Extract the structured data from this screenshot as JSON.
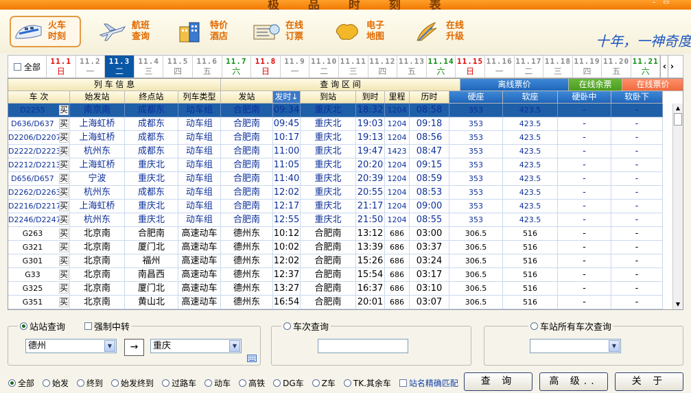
{
  "window": {
    "title": "极 品 时 刻 表",
    "btn_min": "–",
    "btn_max": "▭"
  },
  "toolbar": {
    "items": [
      {
        "label": "火车时刻",
        "icon": "train-icon"
      },
      {
        "label": "航班查询",
        "icon": "airplane-icon"
      },
      {
        "label": "特价酒店",
        "icon": "hotel-icon"
      },
      {
        "label": "在线订票",
        "icon": "ticket-icon"
      },
      {
        "label": "电子地图",
        "icon": "map-icon"
      },
      {
        "label": "在线升级",
        "icon": "upgrade-icon"
      }
    ],
    "signature": "十年，一神奇度"
  },
  "dates": {
    "all_label": "全部",
    "items": [
      {
        "d": "11.1",
        "w": "日",
        "type": "sun"
      },
      {
        "d": "11.2",
        "w": "一",
        "type": ""
      },
      {
        "d": "11.3",
        "w": "二",
        "type": "sel"
      },
      {
        "d": "11.4",
        "w": "三",
        "type": ""
      },
      {
        "d": "11.5",
        "w": "四",
        "type": ""
      },
      {
        "d": "11.6",
        "w": "五",
        "type": ""
      },
      {
        "d": "11.7",
        "w": "六",
        "type": "sat"
      },
      {
        "d": "11.8",
        "w": "日",
        "type": "sun"
      },
      {
        "d": "11.9",
        "w": "一",
        "type": ""
      },
      {
        "d": "11.10",
        "w": "二",
        "type": ""
      },
      {
        "d": "11.11",
        "w": "三",
        "type": ""
      },
      {
        "d": "11.12",
        "w": "四",
        "type": ""
      },
      {
        "d": "11.13",
        "w": "五",
        "type": ""
      },
      {
        "d": "11.14",
        "w": "六",
        "type": "sat"
      },
      {
        "d": "11.15",
        "w": "日",
        "type": "sun"
      },
      {
        "d": "11.16",
        "w": "一",
        "type": ""
      },
      {
        "d": "11.17",
        "w": "二",
        "type": ""
      },
      {
        "d": "11.18",
        "w": "三",
        "type": ""
      },
      {
        "d": "11.19",
        "w": "四",
        "type": ""
      },
      {
        "d": "11.20",
        "w": "五",
        "type": ""
      },
      {
        "d": "11.21",
        "w": "六",
        "type": "sat"
      }
    ]
  },
  "table": {
    "group_headers": {
      "train_info": "列 车 信 息",
      "query_range": "查 询 区 间",
      "offline_price": "离线票价",
      "online_remaining": "在线余票",
      "online_price": "在线票价"
    },
    "columns": [
      "车 次",
      "始发站",
      "终点站",
      "列车类型",
      "发站",
      "发时↓",
      "到站",
      "到时",
      "里程",
      "历时",
      "硬座",
      "软座",
      "硬卧中",
      "软卧下"
    ],
    "buy_label": "买",
    "rows": [
      [
        "D2255",
        "南京南",
        "成都东",
        "动车组",
        "合肥南",
        "09:34",
        "重庆北",
        "18:32",
        "1204",
        "08:58",
        "353",
        "423.5",
        "-",
        "-"
      ],
      [
        "D636/D637",
        "上海虹桥",
        "成都东",
        "动车组",
        "合肥南",
        "09:45",
        "重庆北",
        "19:03",
        "1204",
        "09:18",
        "353",
        "423.5",
        "-",
        "-"
      ],
      [
        "D2206/D2207",
        "上海虹桥",
        "成都东",
        "动车组",
        "合肥南",
        "10:17",
        "重庆北",
        "19:13",
        "1204",
        "08:56",
        "353",
        "423.5",
        "-",
        "-"
      ],
      [
        "D2222/D2223",
        "杭州东",
        "成都东",
        "动车组",
        "合肥南",
        "11:00",
        "重庆北",
        "19:47",
        "1423",
        "08:47",
        "353",
        "423.5",
        "-",
        "-"
      ],
      [
        "D2212/D2213",
        "上海虹桥",
        "重庆北",
        "动车组",
        "合肥南",
        "11:05",
        "重庆北",
        "20:20",
        "1204",
        "09:15",
        "353",
        "423.5",
        "-",
        "-"
      ],
      [
        "D656/D657",
        "宁波",
        "重庆北",
        "动车组",
        "合肥南",
        "11:40",
        "重庆北",
        "20:39",
        "1204",
        "08:59",
        "353",
        "423.5",
        "-",
        "-"
      ],
      [
        "D2262/D2263",
        "杭州东",
        "成都东",
        "动车组",
        "合肥南",
        "12:02",
        "重庆北",
        "20:55",
        "1204",
        "08:53",
        "353",
        "423.5",
        "-",
        "-"
      ],
      [
        "D2216/D2217",
        "上海虹桥",
        "重庆北",
        "动车组",
        "合肥南",
        "12:17",
        "重庆北",
        "21:17",
        "1204",
        "09:00",
        "353",
        "423.5",
        "-",
        "-"
      ],
      [
        "D2246/D2247",
        "杭州东",
        "重庆北",
        "动车组",
        "合肥南",
        "12:55",
        "重庆北",
        "21:50",
        "1204",
        "08:55",
        "353",
        "423.5",
        "-",
        "-"
      ],
      [
        "G263",
        "北京南",
        "合肥南",
        "高速动车",
        "德州东",
        "10:12",
        "合肥南",
        "13:12",
        "686",
        "03:00",
        "306.5",
        "516",
        "-",
        "-"
      ],
      [
        "G321",
        "北京南",
        "厦门北",
        "高速动车",
        "德州东",
        "10:02",
        "合肥南",
        "13:39",
        "686",
        "03:37",
        "306.5",
        "516",
        "-",
        "-"
      ],
      [
        "G301",
        "北京南",
        "福州",
        "高速动车",
        "德州东",
        "12:02",
        "合肥南",
        "15:26",
        "686",
        "03:24",
        "306.5",
        "516",
        "-",
        "-"
      ],
      [
        "G33",
        "北京南",
        "南昌西",
        "高速动车",
        "德州东",
        "12:37",
        "合肥南",
        "15:54",
        "686",
        "03:17",
        "306.5",
        "516",
        "-",
        "-"
      ],
      [
        "G325",
        "北京南",
        "厦门北",
        "高速动车",
        "德州东",
        "13:27",
        "合肥南",
        "16:37",
        "686",
        "03:10",
        "306.5",
        "516",
        "-",
        "-"
      ],
      [
        "G351",
        "北京南",
        "黄山北",
        "高速动车",
        "德州东",
        "16:54",
        "合肥南",
        "20:01",
        "686",
        "03:07",
        "306.5",
        "516",
        "-",
        "-"
      ]
    ]
  },
  "search": {
    "station_query": "站站查询",
    "force_transfer": "强制中转",
    "from": "德州",
    "to": "重庆",
    "swap_symbol": "→",
    "train_query": "车次查询",
    "station_all_query": "车站所有车次查询"
  },
  "filters": [
    "全部",
    "始发",
    "终到",
    "始发终到",
    "过路车",
    "动车",
    "高铁",
    "DG车",
    "Z车",
    "TK.其余车"
  ],
  "exact_match": "站名精确匹配",
  "buttons": {
    "query": "查 询",
    "advanced": "高 级..",
    "about": "关 于"
  }
}
